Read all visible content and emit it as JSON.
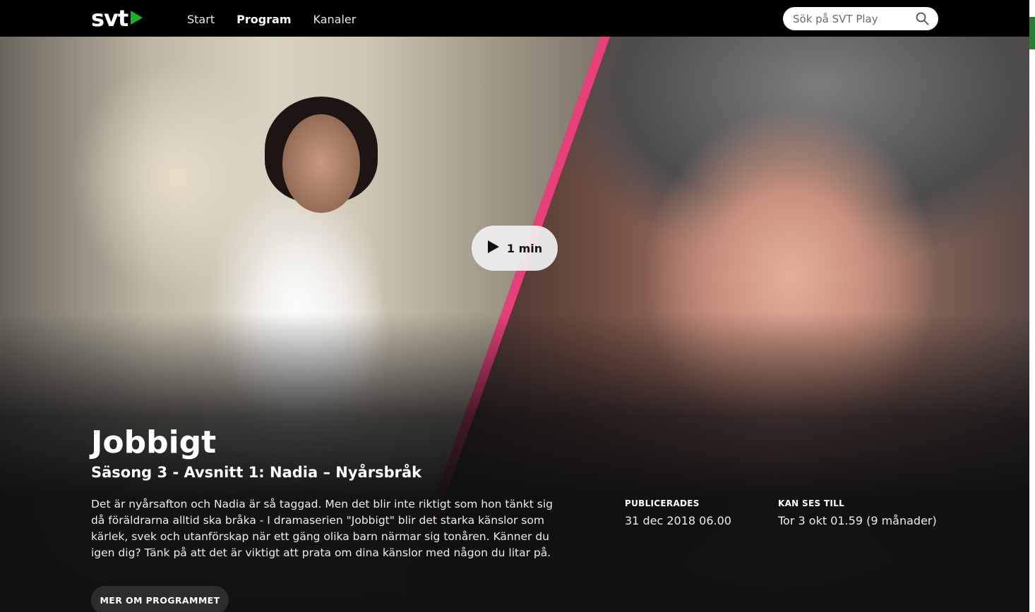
{
  "app": {
    "logo_text": "svt",
    "brand_green": "#1ab02c"
  },
  "nav": {
    "items": [
      {
        "label": "Start",
        "active": false
      },
      {
        "label": "Program",
        "active": true
      },
      {
        "label": "Kanaler",
        "active": false
      }
    ]
  },
  "search": {
    "placeholder": "Sök på SVT Play",
    "icon": "search-icon"
  },
  "hero": {
    "play_label": "1 min",
    "title": "Jobbigt",
    "subtitle": "Säsong 3 - Avsnitt 1: Nadia – Nyårsbråk",
    "description": "Det är nyårsafton och Nadia är så taggad. Men det blir inte riktigt som hon tänkt sig då föräldrarna alltid ska bråka - I dramaserien \"Jobbigt\" blir det starka känslor som kärlek, svek och utanförskap när ett gäng olika barn närmar sig tonåren. Känner du igen dig? Tänk på att det är viktigt att prata om dina känslor med någon du litar på.",
    "published_label": "PUBLICERADES",
    "published_value": "31 dec 2018 06.00",
    "available_label": "KAN SES TILL",
    "available_value": "Tor 3 okt 01.59 (9 månader)",
    "more_button": "MER OM PROGRAMMET",
    "accent_stripe": "#e6407a"
  }
}
